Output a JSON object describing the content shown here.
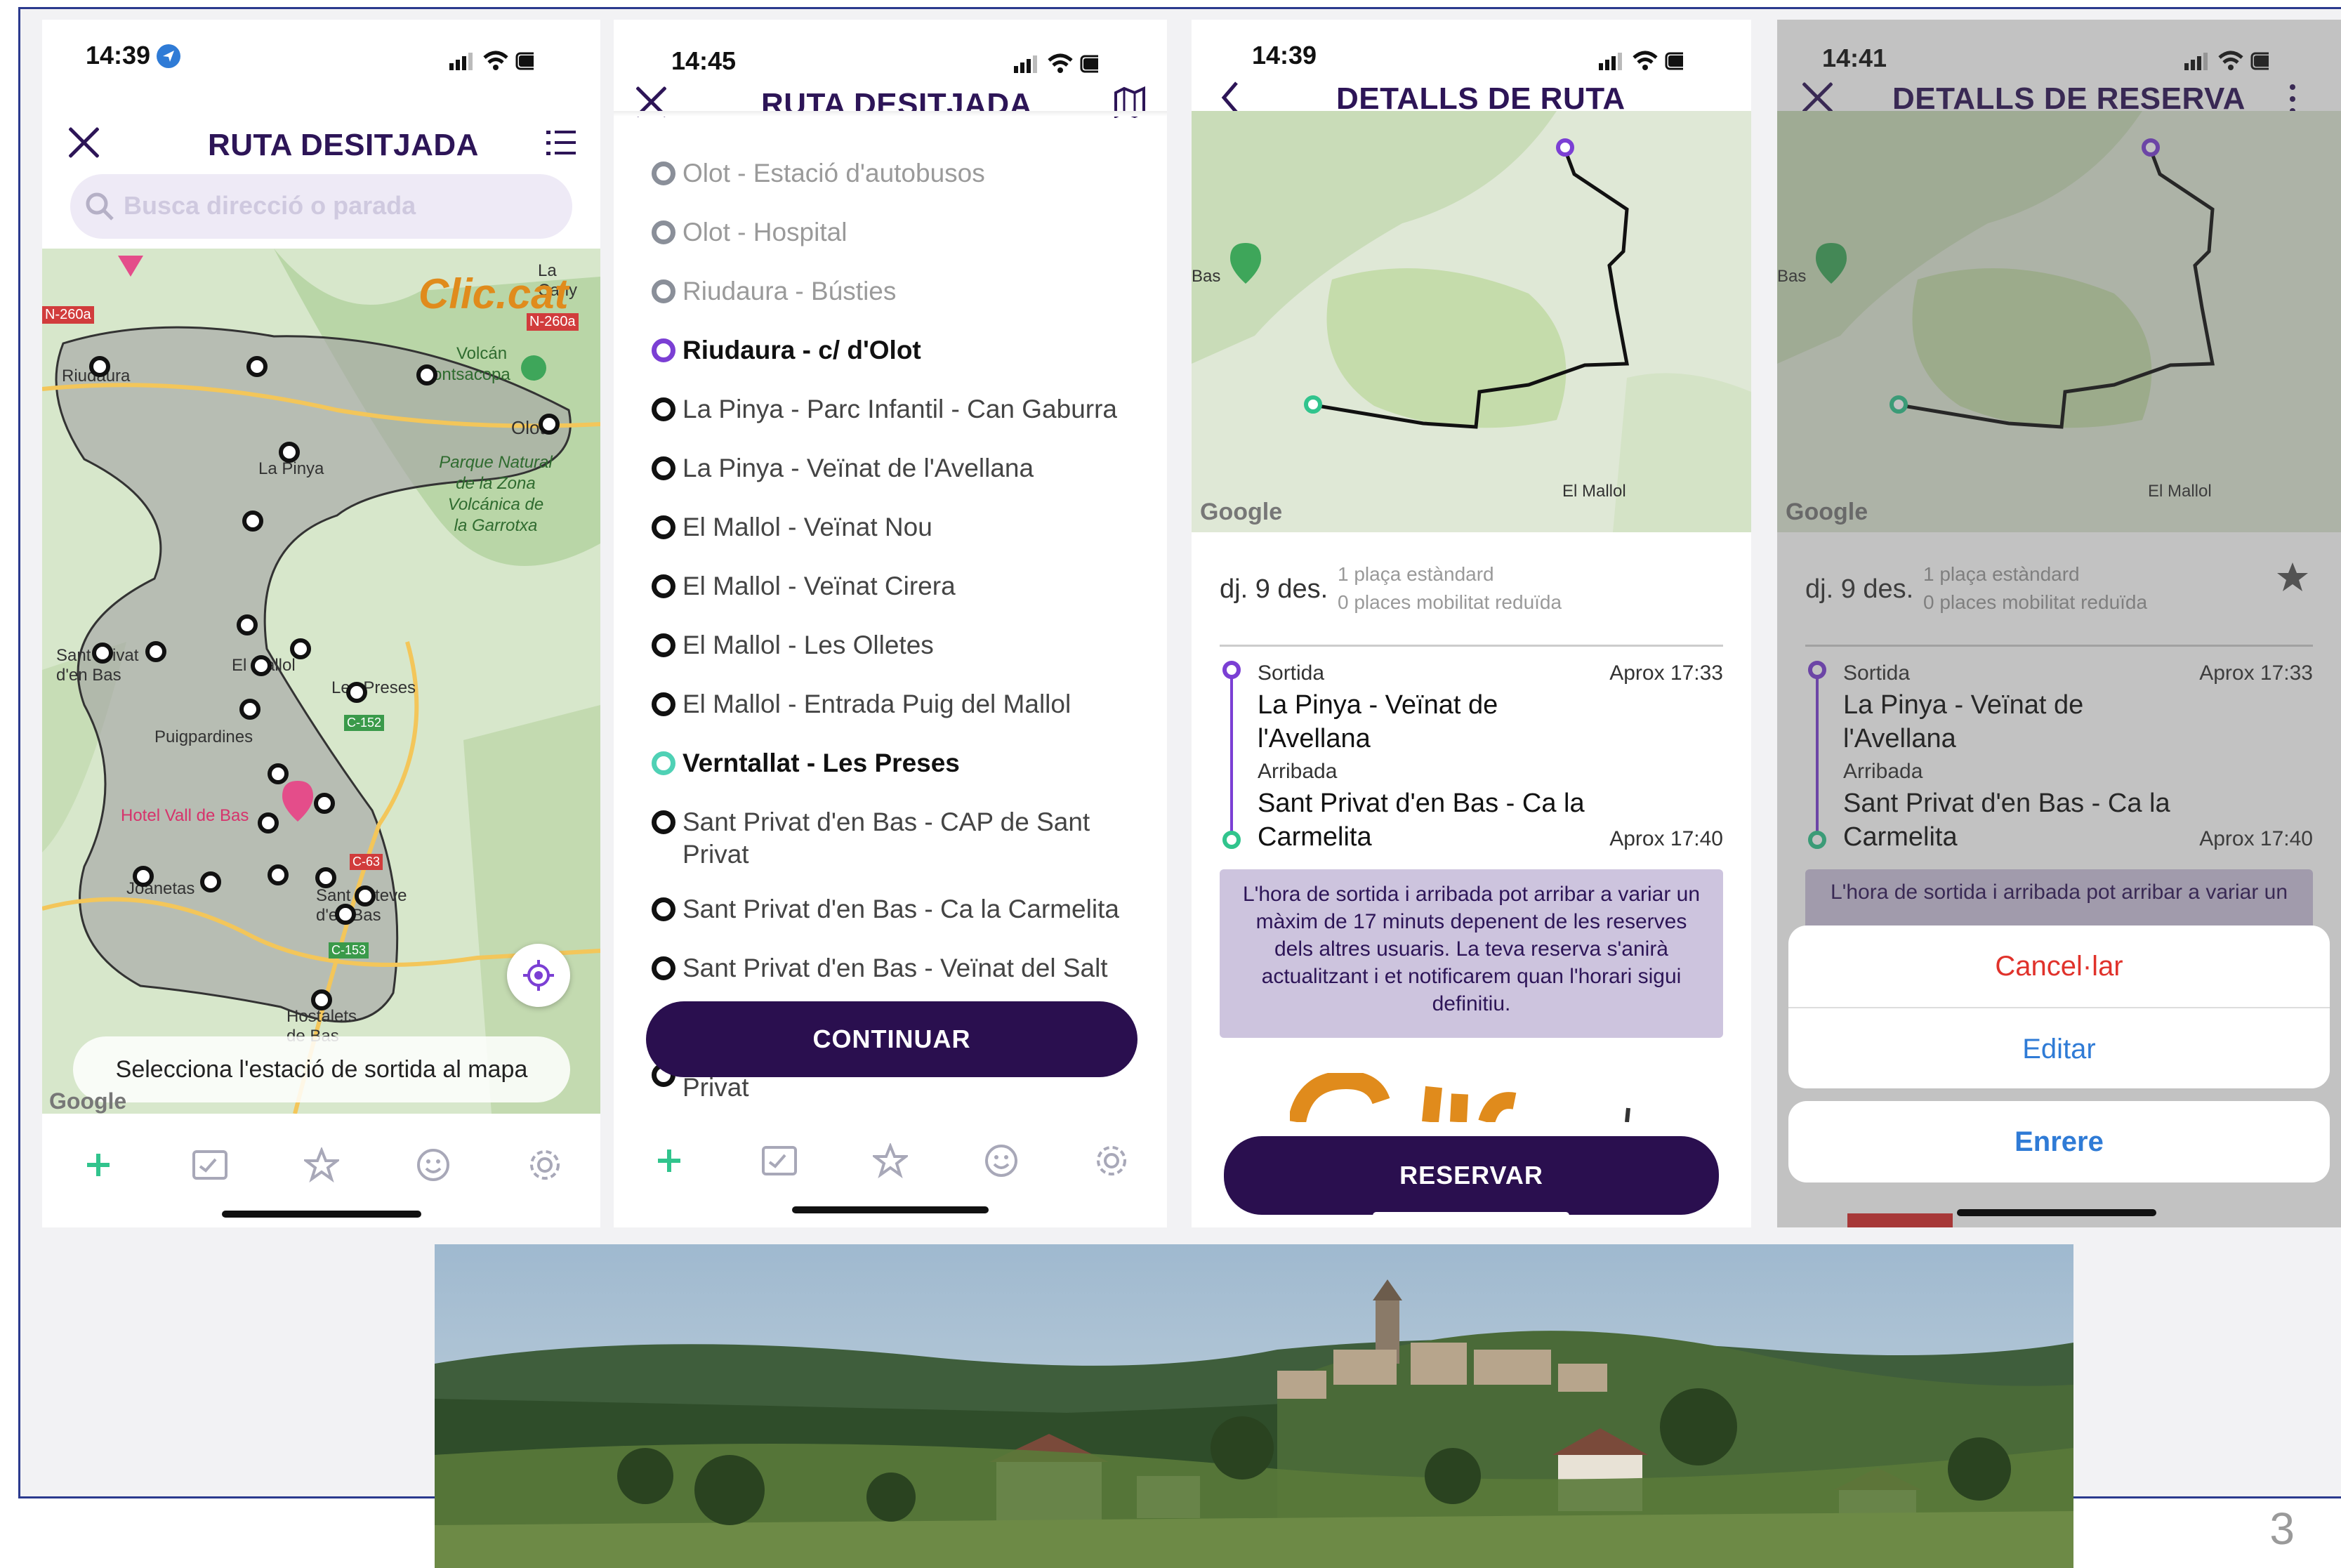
{
  "slide_number": "3",
  "screen1": {
    "time": "14:39",
    "title": "RUTA DESITJADA",
    "search_placeholder": "Busca direcció o parada",
    "map_labels": {
      "brand": "Clic.cat",
      "la_canya": "La Cany",
      "n260a_left": "N-260a",
      "n260a_right": "N-260a",
      "volcan": "Volcán",
      "montsacopa": "Montsacopa",
      "riudaura": "Riudaura",
      "olot": "Olot",
      "la_pinya": "La Pinya",
      "parque": "Parque Natural\nde la Zona\nVolcánica de\nla Garrotxa",
      "sant_privat": "Sant Privat\nd'en Bas",
      "el_mallol": "El Mallol",
      "les_preses": "Les Preses",
      "c152": "C-152",
      "puigpardines": "Puigpardines",
      "hotel": "Hotel Vall de Bas",
      "c63": "C-63",
      "joanetas": "Joanetas",
      "sant_esteve": "Sant Esteve\nd'en Bas",
      "c153": "C-153",
      "hostalets": "Hostalets\nde Bas",
      "google": "Google"
    },
    "bottom_hint": "Selecciona l'estació de sortida al mapa"
  },
  "screen2": {
    "time": "14:45",
    "title": "RUTA DESITJADA",
    "stops": [
      {
        "name": "Olot - Estació d'autobusos",
        "state": "past"
      },
      {
        "name": "Olot - Hospital",
        "state": "past"
      },
      {
        "name": "Riudaura - Bústies",
        "state": "past"
      },
      {
        "name": "Riudaura - c/ d'Olot",
        "state": "selected"
      },
      {
        "name": "La Pinya - Parc Infantil - Can Gaburra",
        "state": "normal"
      },
      {
        "name": "La Pinya - Veïnat de l'Avellana",
        "state": "normal"
      },
      {
        "name": "El Mallol - Veïnat Nou",
        "state": "normal"
      },
      {
        "name": "El Mallol - Veïnat Cirera",
        "state": "normal"
      },
      {
        "name": "El Mallol - Les Olletes",
        "state": "normal"
      },
      {
        "name": "El Mallol - Entrada Puig del Mallol",
        "state": "normal"
      },
      {
        "name": "Verntallat - Les Preses",
        "state": "destination"
      },
      {
        "name": "Sant Privat d'en Bas - CAP de Sant Privat",
        "state": "normal"
      },
      {
        "name": "Sant Privat d'en Bas - Ca la Carmelita",
        "state": "normal"
      },
      {
        "name": "Sant Privat d'en Bas - Veïnat del Salt",
        "state": "normal"
      }
    ],
    "last_partial": "Privat",
    "continue_label": "CONTINUAR"
  },
  "screen3": {
    "time": "14:39",
    "title": "DETALLS DE RUTA",
    "map_bas": "Bas",
    "map_el_mallol": "El Mallol",
    "google": "Google",
    "date": "dj. 9 des.",
    "seats_standard": "1 plaça estàndard",
    "seats_reduced": "0 places mobilitat reduïda",
    "departure_label": "Sortida",
    "departure_time": "Aprox 17:33",
    "departure_stop": "La Pinya - Veïnat de l'Avellana",
    "arrival_label": "Arribada",
    "arrival_stop": "Sant Privat d'en Bas - Ca la Carmelita",
    "arrival_time": "Aprox 17:40",
    "notice": "L'hora de sortida i arribada pot arribar a variar un màxim de 17 minuts depenent de les reserves dels altres usuaris. La teva reserva s'anirà actualitzant i et notificarem quan l'horari sigui definitiu.",
    "reserve_label": "RESERVAR"
  },
  "screen4": {
    "time": "14:41",
    "title": "DETALLS DE RESERVA",
    "map_bas": "Bas",
    "map_el_mallol": "El Mallol",
    "google": "Google",
    "date": "dj. 9 des.",
    "seats_standard": "1 plaça estàndard",
    "seats_reduced": "0 places mobilitat reduïda",
    "departure_label": "Sortida",
    "departure_time": "Aprox 17:33",
    "departure_stop": "La Pinya - Veïnat de l'Avellana",
    "arrival_label": "Arribada",
    "arrival_stop": "Sant Privat d'en Bas - Ca la Carmelita",
    "arrival_time": "Aprox 17:40",
    "notice_partial": "L'hora de sortida i arribada pot arribar a variar un",
    "cancel_label": "Cancel·lar",
    "edit_label": "Editar",
    "back_label": "Enrere"
  },
  "colors": {
    "brand_dark": "#2a0f4f",
    "accent_purple": "#7b3fd4",
    "accent_green": "#31c48d",
    "cancel_red": "#e0322b",
    "ios_blue": "#2f7bd6"
  }
}
